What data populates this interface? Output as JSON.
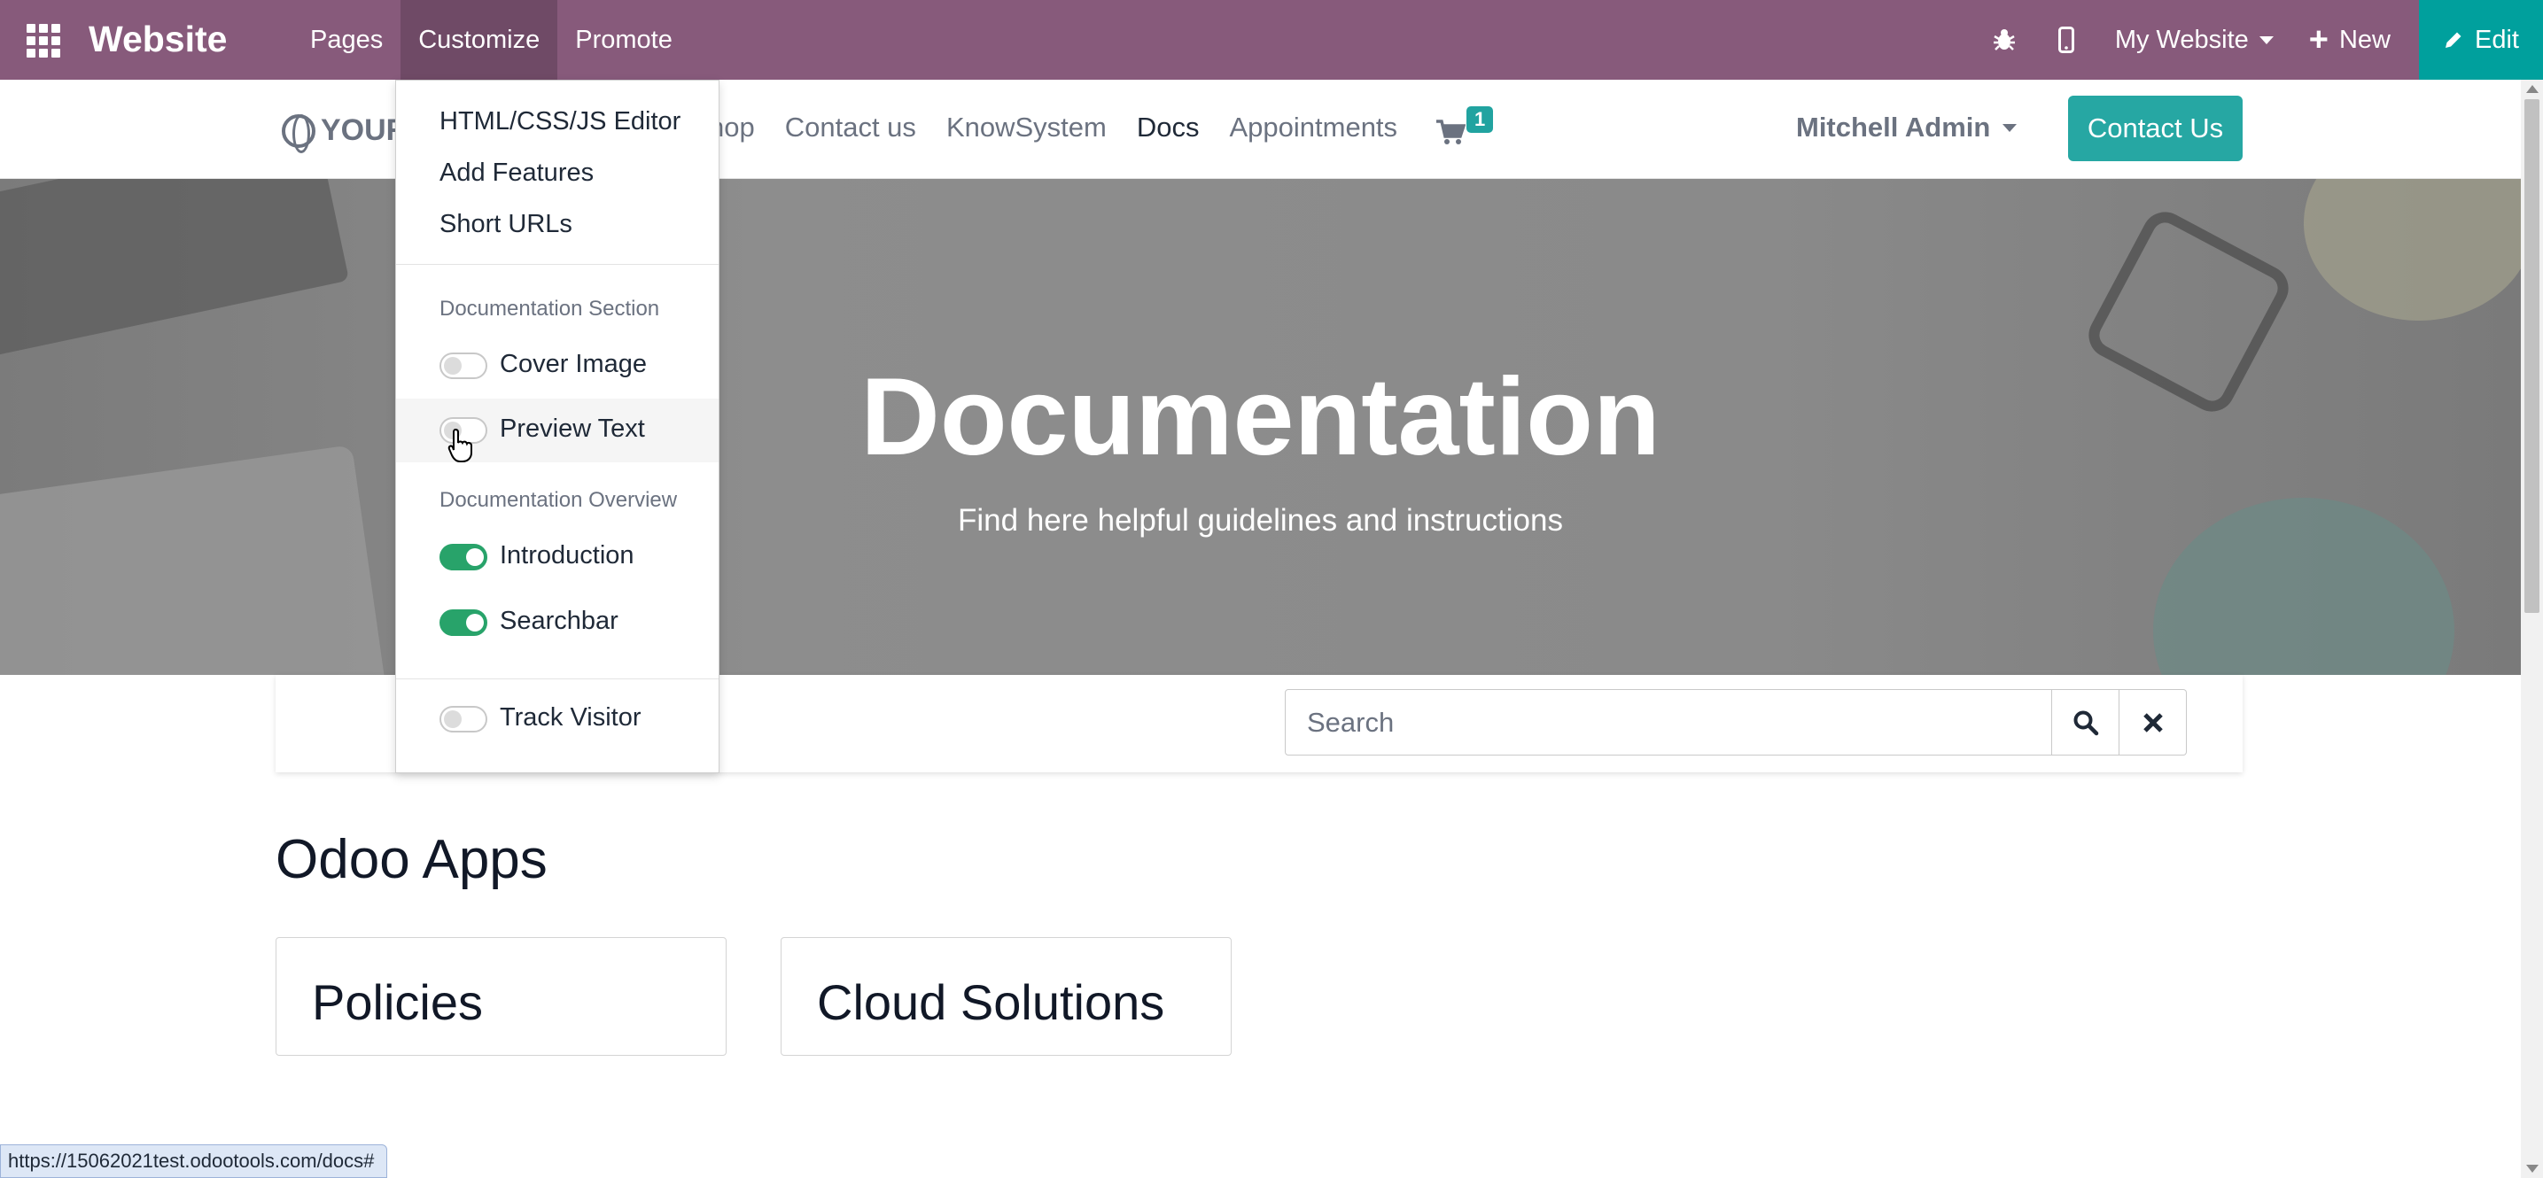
{
  "topbar": {
    "app_name": "Website",
    "menu": [
      "Pages",
      "Customize",
      "Promote"
    ],
    "active_menu": "Customize",
    "website_selector": "My Website",
    "new_label": "New",
    "edit_label": "Edit",
    "colors": {
      "bar": "#875a7b",
      "edit": "#00a09d"
    }
  },
  "site_header": {
    "logo_text": "YOUR",
    "nav": [
      "hop",
      "Contact us",
      "KnowSystem",
      "Docs",
      "Appointments"
    ],
    "cart_count": "1",
    "user_name": "Mitchell Admin",
    "contact_button": "Contact Us"
  },
  "hero": {
    "title": "Documentation",
    "subtitle": "Find here helpful guidelines and instructions"
  },
  "search": {
    "placeholder": "Search",
    "value": ""
  },
  "content": {
    "section_title": "Odoo Apps",
    "cards": [
      "Policies",
      "Cloud Solutions"
    ]
  },
  "customize_menu": {
    "items": [
      "HTML/CSS/JS Editor",
      "Add Features",
      "Short URLs"
    ],
    "section1_header": "Documentation Section",
    "section1_toggles": [
      {
        "label": "Cover Image",
        "checked": false
      },
      {
        "label": "Preview Text",
        "checked": false
      }
    ],
    "section2_header": "Documentation Overview",
    "section2_toggles": [
      {
        "label": "Introduction",
        "checked": true
      },
      {
        "label": "Searchbar",
        "checked": true
      }
    ],
    "extra_toggles": [
      {
        "label": "Track Visitor",
        "checked": false
      }
    ]
  },
  "status_bar": {
    "url": "https://15062021test.odootools.com/docs#"
  }
}
